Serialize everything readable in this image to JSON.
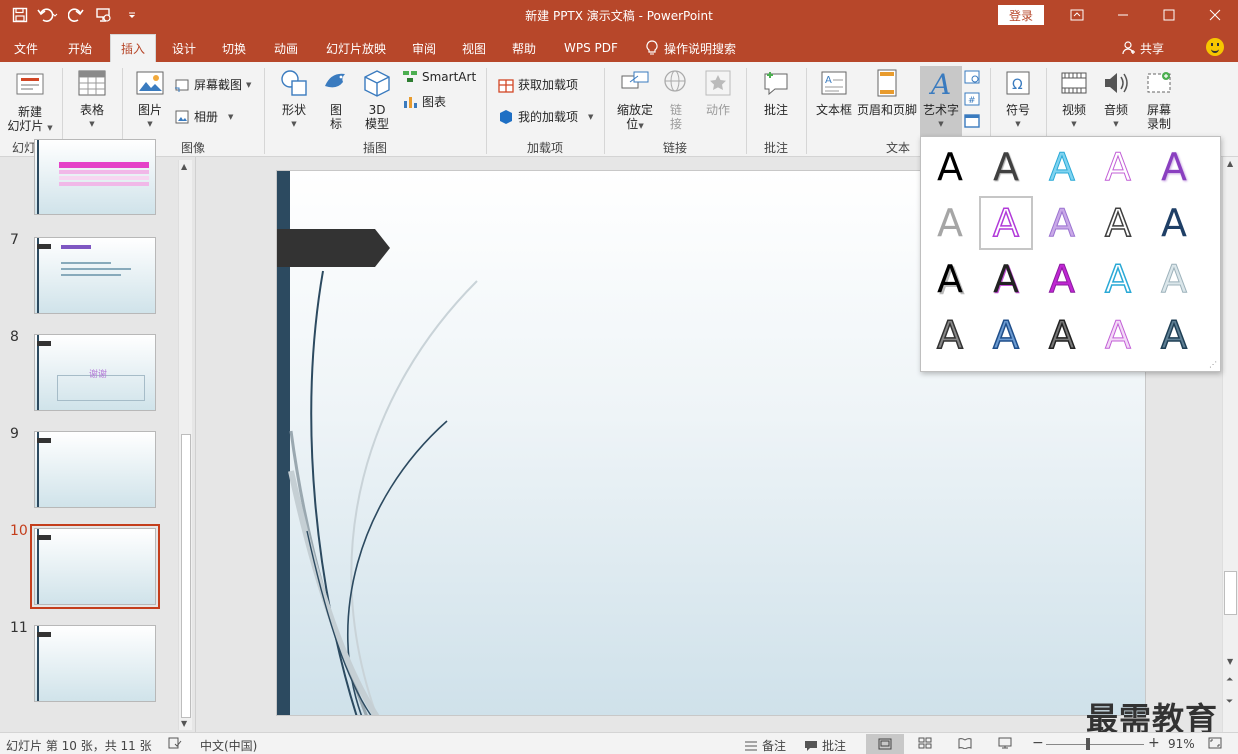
{
  "window": {
    "title": "新建 PPTX 演示文稿 - PowerPoint",
    "login": "登录"
  },
  "tabs": [
    "文件",
    "开始",
    "插入",
    "设计",
    "切换",
    "动画",
    "幻灯片放映",
    "审阅",
    "视图",
    "帮助",
    "WPS PDF"
  ],
  "active_tab": "插入",
  "tell_me": "操作说明搜索",
  "share": "共享",
  "ribbon": {
    "slides": {
      "new_slide_1": "新建",
      "new_slide_2": "幻灯片",
      "group": "幻灯片"
    },
    "tables": {
      "table": "表格",
      "group": "表格"
    },
    "images": {
      "picture": "图片",
      "screenshot": "屏幕截图",
      "album": "相册",
      "group": "图像"
    },
    "illustrations": {
      "shapes": "形状",
      "icons_1": "图",
      "icons_2": "标",
      "model_1": "3D",
      "model_2": "模型",
      "smartart": "SmartArt",
      "chart": "图表",
      "group": "插图"
    },
    "addins": {
      "get": "获取加载项",
      "mine": "我的加载项",
      "group": "加载项"
    },
    "links": {
      "zoom_1": "缩放定",
      "zoom_2": "位",
      "link_1": "链",
      "link_2": "接",
      "action": "动作",
      "group": "链接"
    },
    "comments": {
      "comment": "批注",
      "group": "批注"
    },
    "text": {
      "textbox": "文本框",
      "header_footer": "页眉和页脚",
      "wordart": "艺术字",
      "group": "文本"
    },
    "symbols": {
      "symbol": "符号"
    },
    "media": {
      "video": "视频",
      "audio": "音频",
      "record_1": "屏幕",
      "record_2": "录制"
    }
  },
  "slides": [
    {
      "num": "7"
    },
    {
      "num": "8",
      "text": "谢谢"
    },
    {
      "num": "9"
    },
    {
      "num": "10"
    },
    {
      "num": "11"
    }
  ],
  "status": {
    "slide_info": "幻灯片 第 10 张，共 11 张",
    "language": "中文(中国)",
    "notes": "备注",
    "comments": "批注",
    "zoom": "91%"
  },
  "wordart_glyph": "A",
  "watermark": "最需教育",
  "colors": {
    "accent": "#b7472a",
    "active_thumb": "#c43e1c",
    "slide_bar": "#2c4a60"
  }
}
